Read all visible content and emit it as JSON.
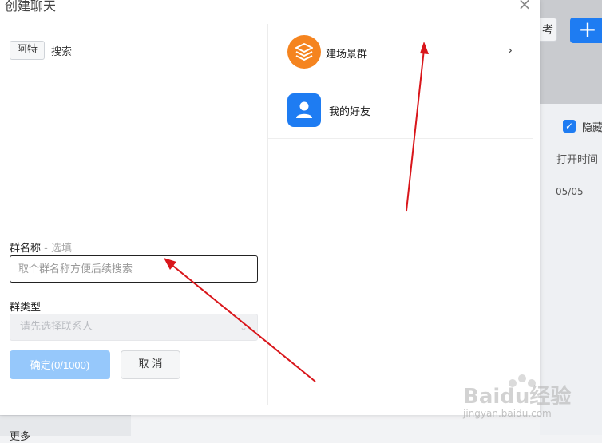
{
  "modal": {
    "title": "创建聊天",
    "close_glyph": "×",
    "at_tag": "阿特",
    "search_label": "搜索",
    "group_name_label": "群名称",
    "group_name_optional": " - 选填",
    "group_name_placeholder": "取个群名称方便后续搜索",
    "group_type_label": "群类型",
    "group_type_placeholder": "请先选择联系人",
    "confirm_label": "确定(0/1000)",
    "cancel_label": "取 消",
    "list": [
      {
        "label": "建场景群",
        "icon": "layers-icon",
        "color": "#f5841f"
      },
      {
        "label": "我的好友",
        "icon": "user-icon",
        "color": "#1e7cf2"
      }
    ]
  },
  "background": {
    "hide_label": "隐藏",
    "open_time_label": "打开时间",
    "date": "05/05",
    "more_label": "更多",
    "plus_glyph": "+"
  },
  "watermark": {
    "brand": "Baidu经验",
    "url": "jingyan.baidu.com"
  },
  "colors": {
    "accent": "#1e7cf2",
    "orange": "#f5841f",
    "confirm_disabled": "#96c8fb",
    "arrow": "#d9161b"
  }
}
